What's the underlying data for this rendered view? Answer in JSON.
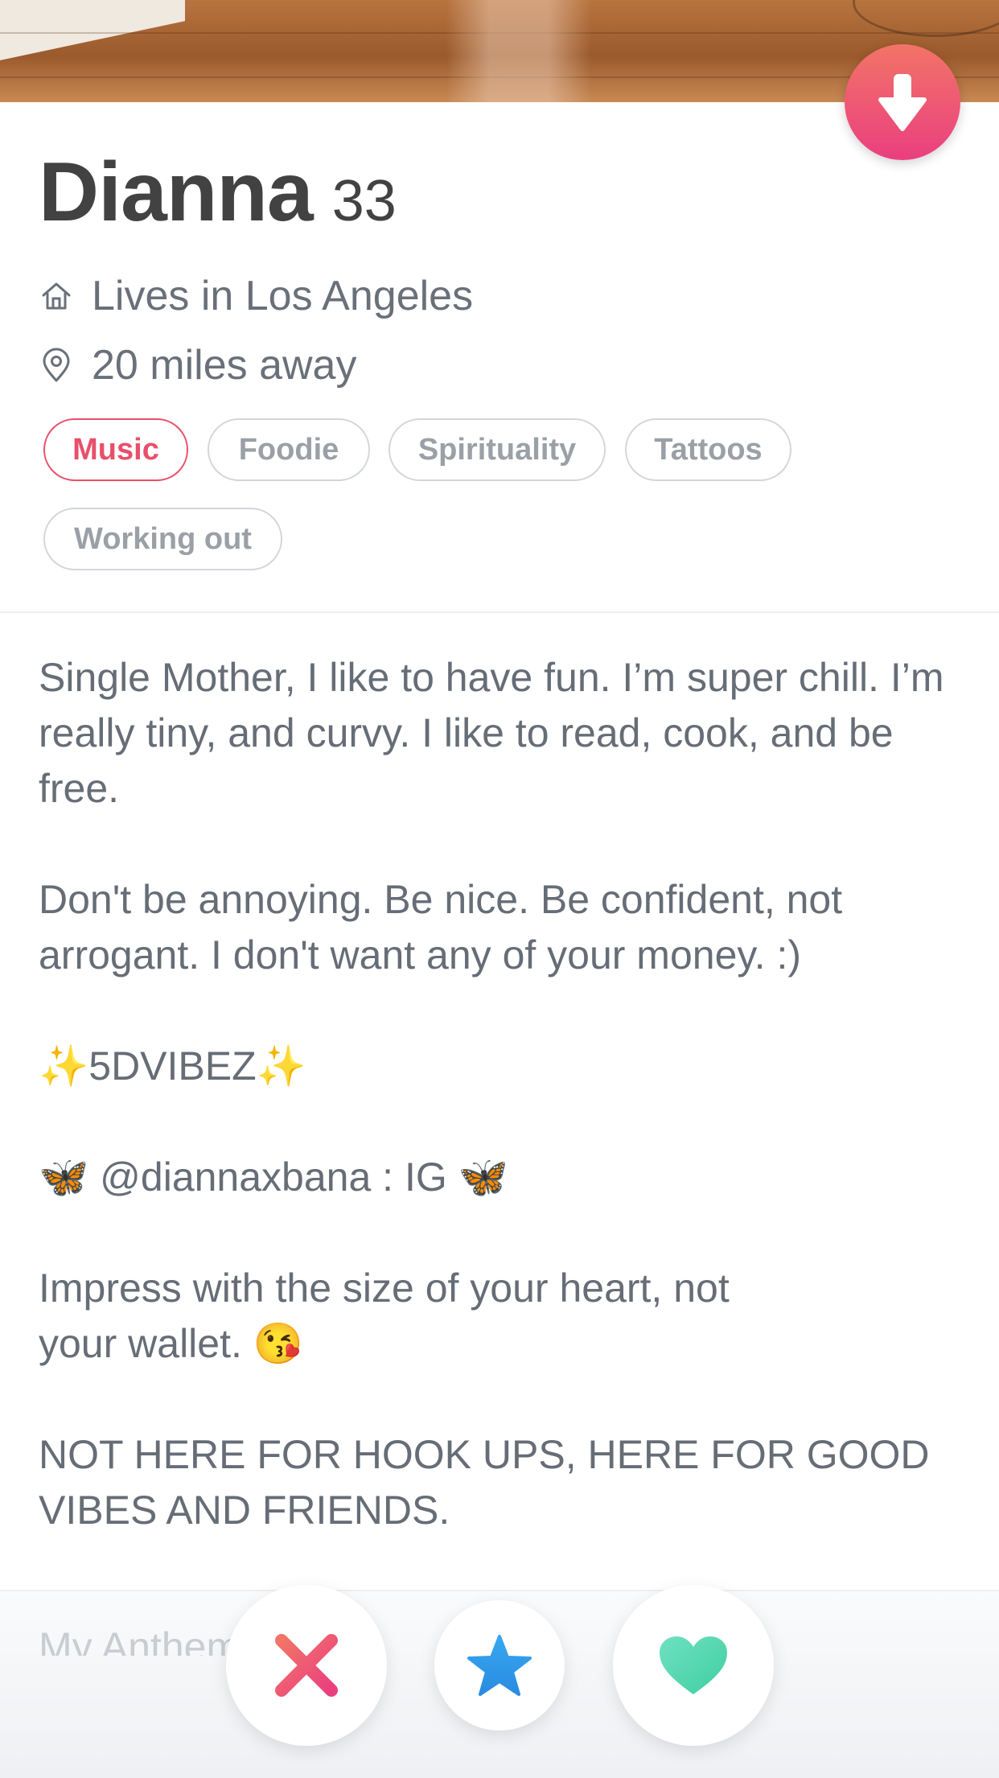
{
  "profile": {
    "name": "Dianna",
    "age": "33",
    "lives_in": "Lives in Los Angeles",
    "distance": "20 miles away"
  },
  "interests": [
    {
      "label": "Music",
      "shared": true
    },
    {
      "label": "Foodie",
      "shared": false
    },
    {
      "label": "Spirituality",
      "shared": false
    },
    {
      "label": "Tattoos",
      "shared": false
    },
    {
      "label": "Working out",
      "shared": false
    }
  ],
  "bio": [
    "Single Mother, I like to have fun. I’m super chill. I’m really tiny, and curvy. I like to read, cook, and be free.",
    "Don't be annoying. Be nice. Be confident, not arrogant. I don't want any of your money. :)",
    "✨5DVIBEZ✨",
    "🦋 @diannaxbana : IG 🦋",
    "Impress with the size of your heart, not\nyour wallet. 😘",
    "NOT HERE FOR HOOK UPS, HERE FOR GOOD VIBES AND FRIENDS."
  ],
  "next_section": "My Anthem",
  "icons": {
    "collapse": "arrow-down-icon",
    "home": "home-icon",
    "location": "location-pin-icon",
    "nope": "close-x-icon",
    "super_like": "star-icon",
    "like": "heart-icon"
  },
  "colors": {
    "accent_gradient": [
      "#f27467",
      "#ea3f7f"
    ],
    "nope": "#f0506a",
    "super_like": "#2f9ae8",
    "like": "#4fd8b0",
    "shared_interest": "#e8506a"
  }
}
